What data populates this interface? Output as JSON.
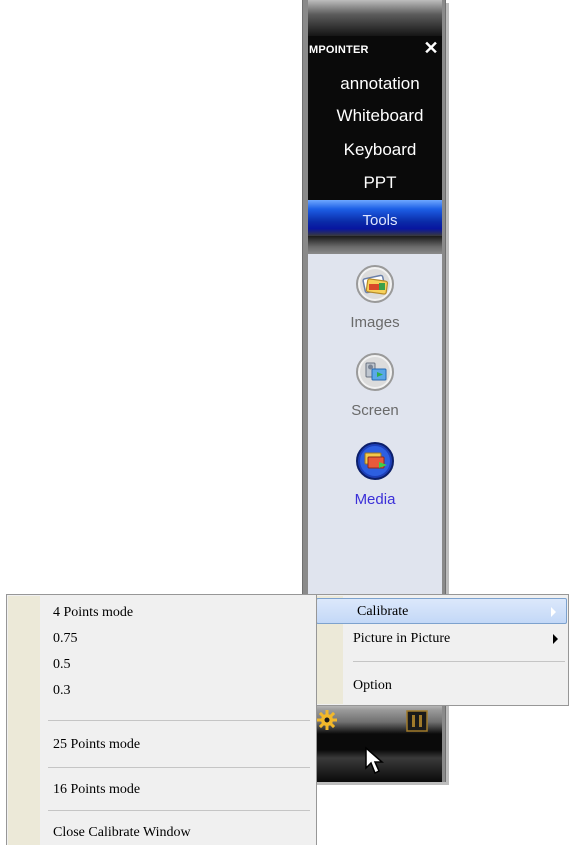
{
  "toolbar": {
    "brand": "MPOINTER",
    "close_glyph": "✕",
    "menu": [
      "annotation",
      "Whiteboard",
      "Keyboard",
      "PPT"
    ],
    "active_menu": "Tools",
    "tools": [
      {
        "label": "Images",
        "icon": "images-icon"
      },
      {
        "label": "Screen",
        "icon": "screen-icon"
      },
      {
        "label": "Media",
        "icon": "media-icon"
      }
    ],
    "bottom_icons": [
      "gear-icon",
      "pause-icon",
      "cursor-icon"
    ]
  },
  "context_menu": {
    "calibrate": "Calibrate",
    "picture_in_picture": "Picture in Picture",
    "option": "Option"
  },
  "calibrate_submenu": {
    "four_points": "4 Points mode",
    "v075": "0.75",
    "v05": "0.5",
    "v03": "0.3",
    "twentyfive_points": "25 Points mode",
    "sixteen_points": "16 Points mode",
    "close_window": "Close Calibrate Window"
  },
  "colors": {
    "tools_blue": "#1d5fe6",
    "media_label": "#3b2fd8",
    "highlight": "#c3d8f7",
    "gutter": "#ece9d8"
  }
}
